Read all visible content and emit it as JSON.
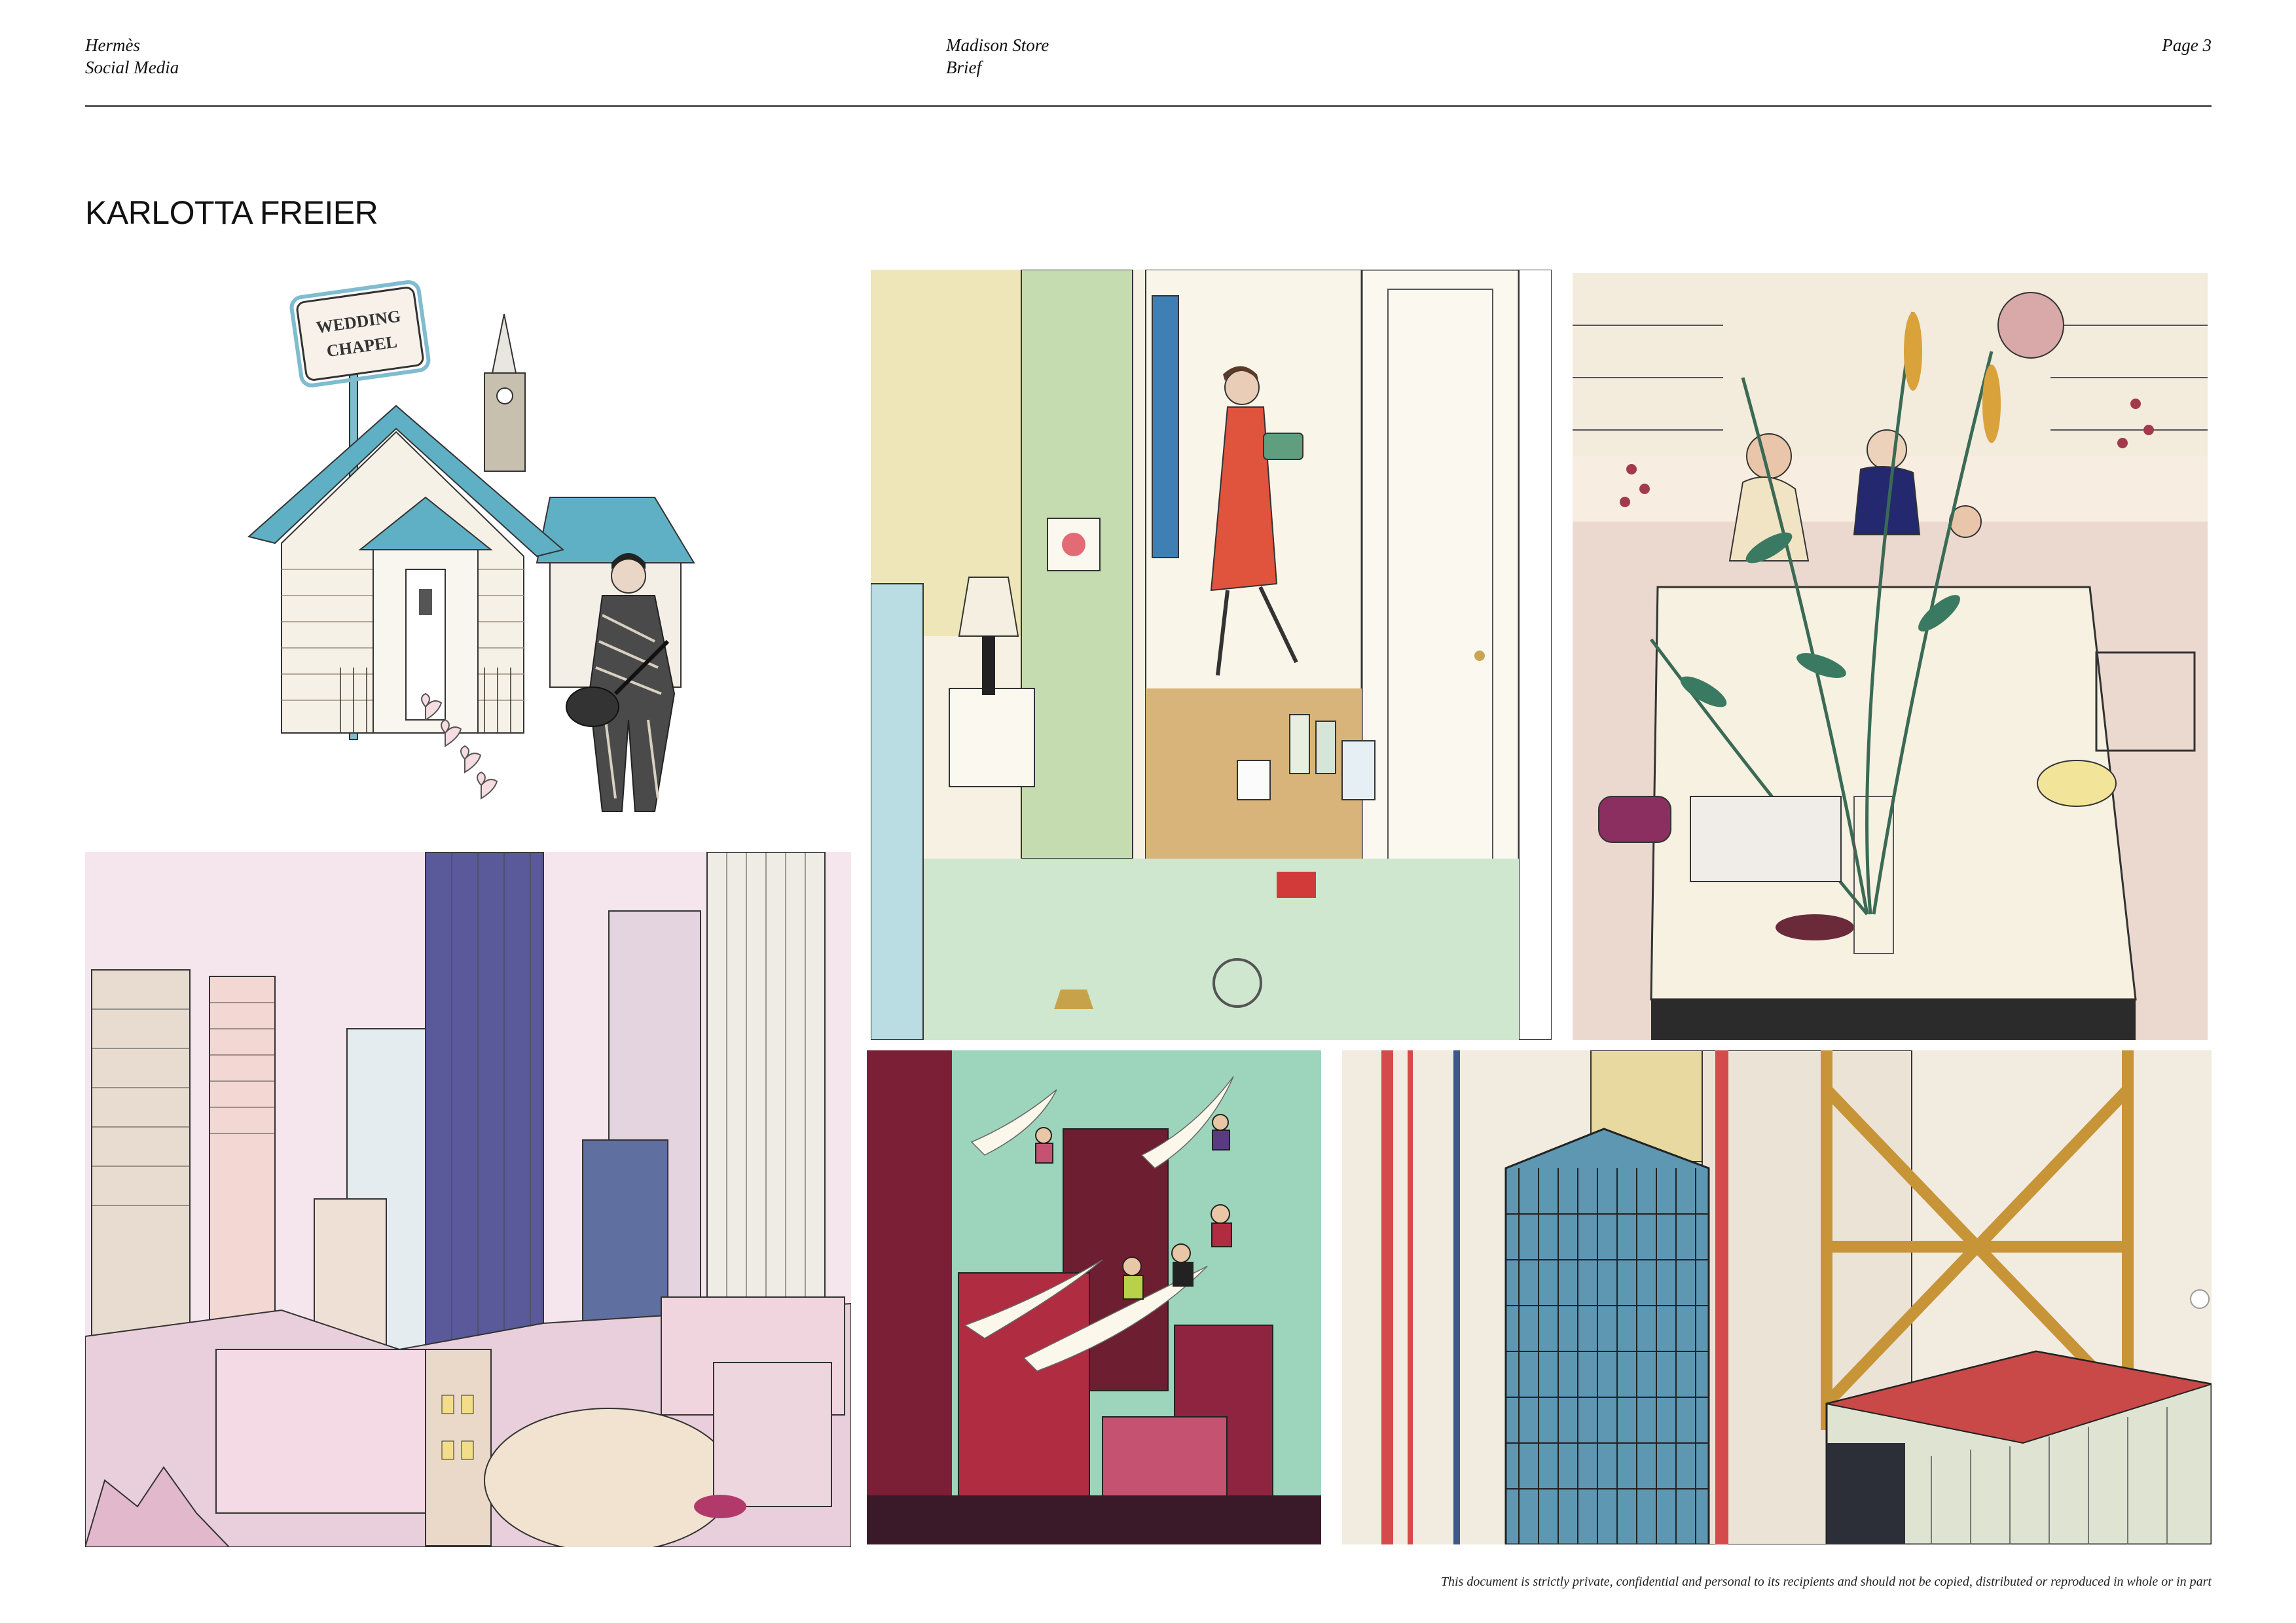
{
  "header": {
    "left": {
      "line1": "Hermès",
      "line2": "Social Media"
    },
    "center": {
      "line1": "Madison Store",
      "line2": "Brief"
    },
    "right": {
      "page": "Page 3"
    }
  },
  "title": "KARLOTTA FREIER",
  "illustrations": {
    "wedding_chapel": {
      "sign_line1": "WEDDING",
      "sign_line2": "CHAPEL"
    }
  },
  "footer": "This document is strictly private, confidential and personal to its recipients and should not be copied, distributed or reproduced in whole or in part",
  "colors": {
    "rule": "#222222",
    "chapel_roof": "#5fb0c4",
    "dress": "#e0533c",
    "sky_pink": "#f5e6ee",
    "sky_green": "#7fcdb0",
    "roof_red": "#d44050"
  }
}
